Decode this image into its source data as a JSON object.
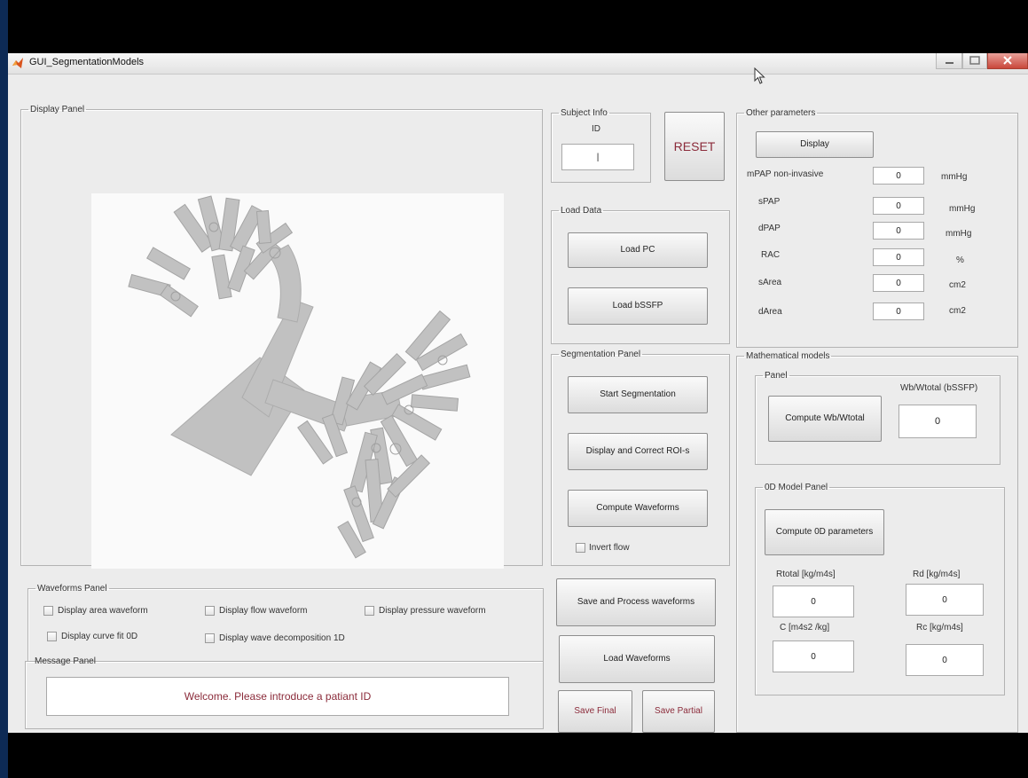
{
  "window": {
    "title": "GUI_SegmentationModels"
  },
  "icons": {
    "app": "matlab-icon",
    "cursor": "mouse-pointer-icon",
    "minimize": "minimize-icon",
    "maximize": "maximize-icon",
    "close": "close-icon"
  },
  "colors": {
    "reset_text": "#8b2b3a",
    "welcome_text": "#8b2b3a",
    "desktop": "#0d2a55"
  },
  "display_panel": {
    "title": "Display Panel",
    "image": "segmented-vessel-tree"
  },
  "subject_info": {
    "title": "Subject Info",
    "id_label": "ID",
    "id_value": "|"
  },
  "reset_label": "RESET",
  "load_data": {
    "title": "Load Data",
    "load_pc": "Load PC",
    "load_bssfp": "Load bSSFP"
  },
  "segmentation": {
    "title": "Segmentation Panel",
    "start": "Start Segmentation",
    "display_correct": "Display and Correct ROI-s",
    "compute_waveforms": "Compute Waveforms",
    "invert_flow": "Invert flow"
  },
  "other_params": {
    "title": "Other parameters",
    "display_label": "Display",
    "rows": [
      {
        "label": "mPAP non-invasive",
        "value": "0",
        "unit": "mmHg"
      },
      {
        "label": "sPAP",
        "value": "0",
        "unit": "mmHg"
      },
      {
        "label": "dPAP",
        "value": "0",
        "unit": "mmHg"
      },
      {
        "label": "RAC",
        "value": "0",
        "unit": "%"
      },
      {
        "label": "sArea",
        "value": "0",
        "unit": "cm2"
      },
      {
        "label": "dArea",
        "value": "0",
        "unit": "cm2"
      }
    ]
  },
  "math_models": {
    "title": "Mathematical models",
    "panel": {
      "title": "Panel",
      "compute_label": "Compute Wb/Wtotal",
      "ratio_label": "Wb/Wtotal (bSSFP)",
      "ratio_value": "0"
    },
    "model0d": {
      "title": "0D Model Panel",
      "compute_label": "Compute 0D parameters",
      "rtotal_label": "Rtotal [kg/m4s]",
      "rtotal_value": "0",
      "rd_label": "Rd [kg/m4s]",
      "rd_value": "0",
      "c_label": "C [m4s2 /kg]",
      "c_value": "0",
      "rc_label": "Rc [kg/m4s]",
      "rc_value": "0"
    }
  },
  "waveforms_panel": {
    "title": "Waveforms Panel",
    "area": "Display area waveform",
    "flow": "Display flow waveform",
    "pressure": "Display pressure waveform",
    "curve_fit": "Display curve fit 0D",
    "decomposition": "Display wave decomposition 1D"
  },
  "message_panel": {
    "title": "Message Panel",
    "message": "Welcome. Please introduce a patiant ID"
  },
  "actions": {
    "save_process": "Save and Process waveforms",
    "load_waveforms": "Load Waveforms",
    "save_final": "Save Final",
    "save_partial": "Save Partial"
  }
}
